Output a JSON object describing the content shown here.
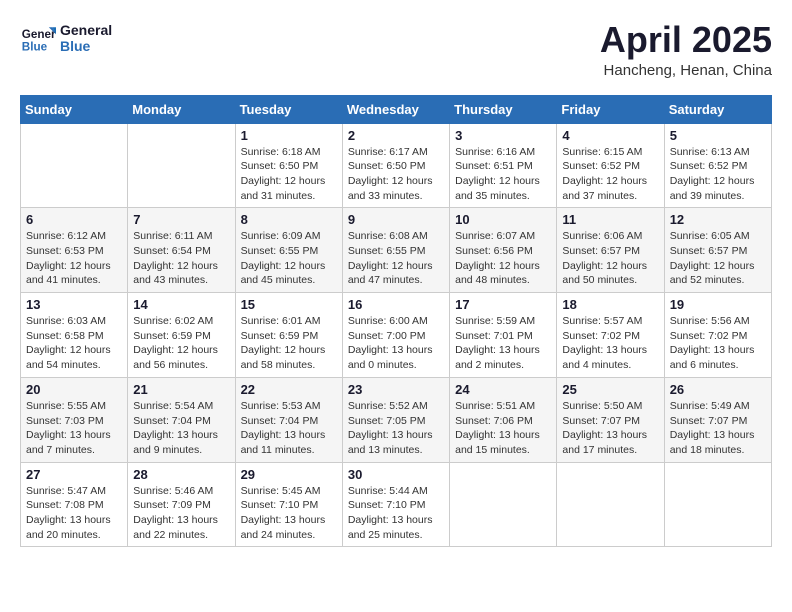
{
  "logo": {
    "line1": "General",
    "line2": "Blue"
  },
  "title": "April 2025",
  "location": "Hancheng, Henan, China",
  "days_header": [
    "Sunday",
    "Monday",
    "Tuesday",
    "Wednesday",
    "Thursday",
    "Friday",
    "Saturday"
  ],
  "weeks": [
    [
      {
        "day": "",
        "info": ""
      },
      {
        "day": "",
        "info": ""
      },
      {
        "day": "1",
        "info": "Sunrise: 6:18 AM\nSunset: 6:50 PM\nDaylight: 12 hours\nand 31 minutes."
      },
      {
        "day": "2",
        "info": "Sunrise: 6:17 AM\nSunset: 6:50 PM\nDaylight: 12 hours\nand 33 minutes."
      },
      {
        "day": "3",
        "info": "Sunrise: 6:16 AM\nSunset: 6:51 PM\nDaylight: 12 hours\nand 35 minutes."
      },
      {
        "day": "4",
        "info": "Sunrise: 6:15 AM\nSunset: 6:52 PM\nDaylight: 12 hours\nand 37 minutes."
      },
      {
        "day": "5",
        "info": "Sunrise: 6:13 AM\nSunset: 6:52 PM\nDaylight: 12 hours\nand 39 minutes."
      }
    ],
    [
      {
        "day": "6",
        "info": "Sunrise: 6:12 AM\nSunset: 6:53 PM\nDaylight: 12 hours\nand 41 minutes."
      },
      {
        "day": "7",
        "info": "Sunrise: 6:11 AM\nSunset: 6:54 PM\nDaylight: 12 hours\nand 43 minutes."
      },
      {
        "day": "8",
        "info": "Sunrise: 6:09 AM\nSunset: 6:55 PM\nDaylight: 12 hours\nand 45 minutes."
      },
      {
        "day": "9",
        "info": "Sunrise: 6:08 AM\nSunset: 6:55 PM\nDaylight: 12 hours\nand 47 minutes."
      },
      {
        "day": "10",
        "info": "Sunrise: 6:07 AM\nSunset: 6:56 PM\nDaylight: 12 hours\nand 48 minutes."
      },
      {
        "day": "11",
        "info": "Sunrise: 6:06 AM\nSunset: 6:57 PM\nDaylight: 12 hours\nand 50 minutes."
      },
      {
        "day": "12",
        "info": "Sunrise: 6:05 AM\nSunset: 6:57 PM\nDaylight: 12 hours\nand 52 minutes."
      }
    ],
    [
      {
        "day": "13",
        "info": "Sunrise: 6:03 AM\nSunset: 6:58 PM\nDaylight: 12 hours\nand 54 minutes."
      },
      {
        "day": "14",
        "info": "Sunrise: 6:02 AM\nSunset: 6:59 PM\nDaylight: 12 hours\nand 56 minutes."
      },
      {
        "day": "15",
        "info": "Sunrise: 6:01 AM\nSunset: 6:59 PM\nDaylight: 12 hours\nand 58 minutes."
      },
      {
        "day": "16",
        "info": "Sunrise: 6:00 AM\nSunset: 7:00 PM\nDaylight: 13 hours\nand 0 minutes."
      },
      {
        "day": "17",
        "info": "Sunrise: 5:59 AM\nSunset: 7:01 PM\nDaylight: 13 hours\nand 2 minutes."
      },
      {
        "day": "18",
        "info": "Sunrise: 5:57 AM\nSunset: 7:02 PM\nDaylight: 13 hours\nand 4 minutes."
      },
      {
        "day": "19",
        "info": "Sunrise: 5:56 AM\nSunset: 7:02 PM\nDaylight: 13 hours\nand 6 minutes."
      }
    ],
    [
      {
        "day": "20",
        "info": "Sunrise: 5:55 AM\nSunset: 7:03 PM\nDaylight: 13 hours\nand 7 minutes."
      },
      {
        "day": "21",
        "info": "Sunrise: 5:54 AM\nSunset: 7:04 PM\nDaylight: 13 hours\nand 9 minutes."
      },
      {
        "day": "22",
        "info": "Sunrise: 5:53 AM\nSunset: 7:04 PM\nDaylight: 13 hours\nand 11 minutes."
      },
      {
        "day": "23",
        "info": "Sunrise: 5:52 AM\nSunset: 7:05 PM\nDaylight: 13 hours\nand 13 minutes."
      },
      {
        "day": "24",
        "info": "Sunrise: 5:51 AM\nSunset: 7:06 PM\nDaylight: 13 hours\nand 15 minutes."
      },
      {
        "day": "25",
        "info": "Sunrise: 5:50 AM\nSunset: 7:07 PM\nDaylight: 13 hours\nand 17 minutes."
      },
      {
        "day": "26",
        "info": "Sunrise: 5:49 AM\nSunset: 7:07 PM\nDaylight: 13 hours\nand 18 minutes."
      }
    ],
    [
      {
        "day": "27",
        "info": "Sunrise: 5:47 AM\nSunset: 7:08 PM\nDaylight: 13 hours\nand 20 minutes."
      },
      {
        "day": "28",
        "info": "Sunrise: 5:46 AM\nSunset: 7:09 PM\nDaylight: 13 hours\nand 22 minutes."
      },
      {
        "day": "29",
        "info": "Sunrise: 5:45 AM\nSunset: 7:10 PM\nDaylight: 13 hours\nand 24 minutes."
      },
      {
        "day": "30",
        "info": "Sunrise: 5:44 AM\nSunset: 7:10 PM\nDaylight: 13 hours\nand 25 minutes."
      },
      {
        "day": "",
        "info": ""
      },
      {
        "day": "",
        "info": ""
      },
      {
        "day": "",
        "info": ""
      }
    ]
  ]
}
